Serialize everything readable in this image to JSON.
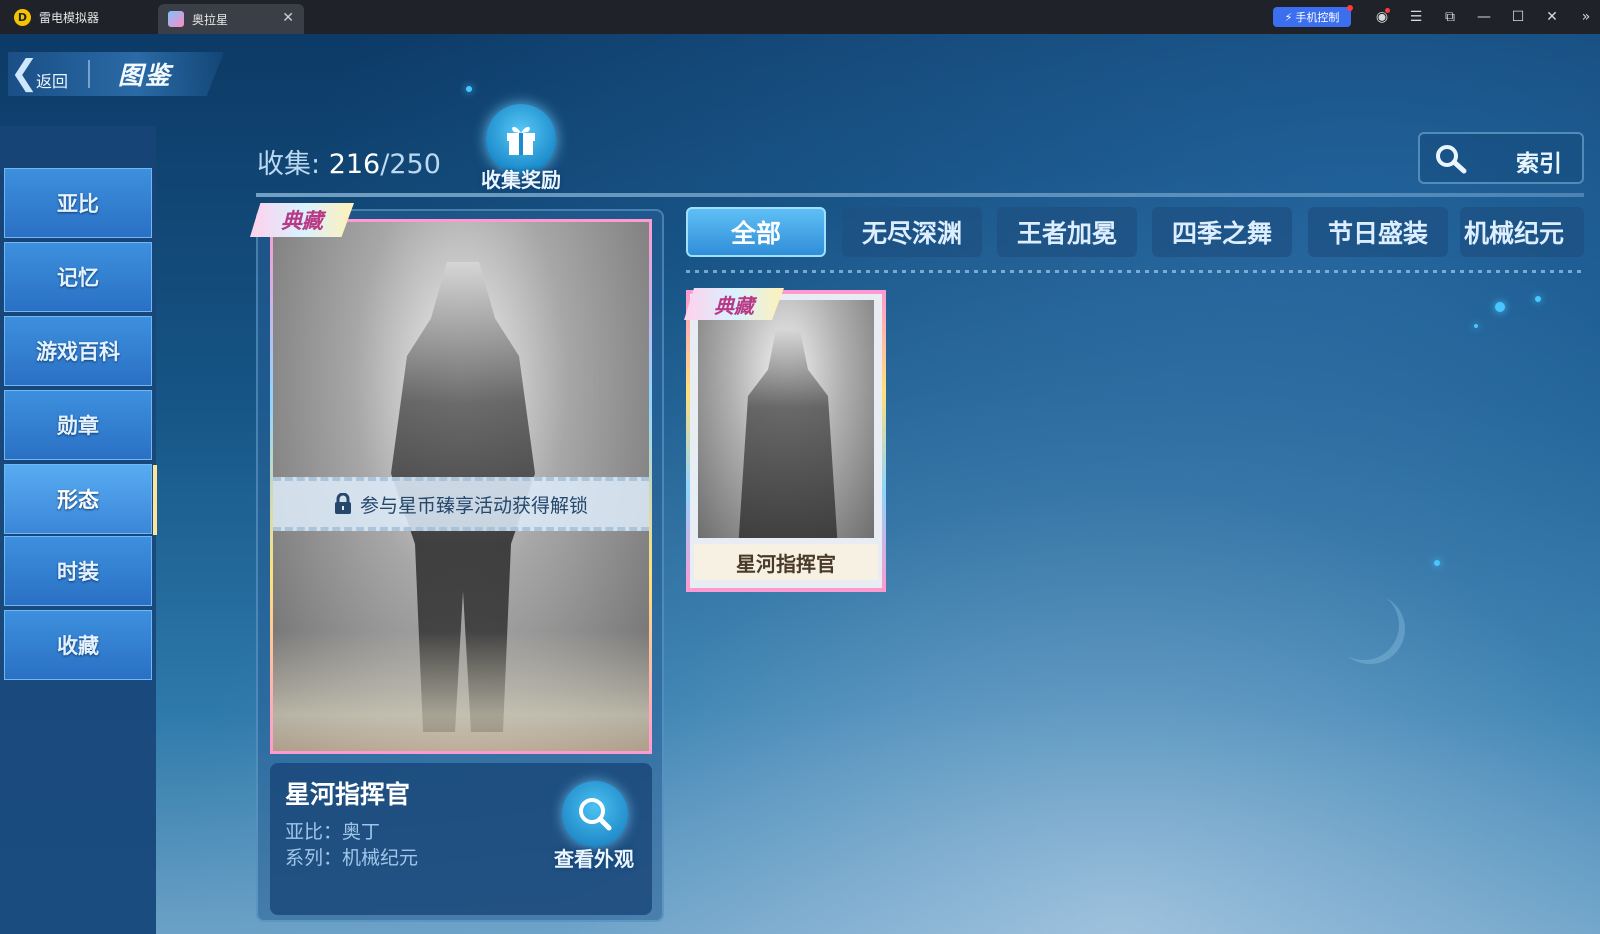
{
  "titlebar": {
    "app_name": "雷电模拟器",
    "tab_title": "奥拉星",
    "tab_close": "✕",
    "phone_control": "手机控制"
  },
  "header": {
    "back_label": "返回",
    "title": "图鉴"
  },
  "sidebar": {
    "items": [
      {
        "label": "亚比"
      },
      {
        "label": "记忆"
      },
      {
        "label": "游戏百科"
      },
      {
        "label": "勋章"
      },
      {
        "label": "形态"
      },
      {
        "label": "时装"
      },
      {
        "label": "收藏"
      }
    ],
    "active_index": 4
  },
  "collection": {
    "label": "收集: ",
    "count": "216",
    "total": "/250",
    "reward_label": "收集奖励"
  },
  "index_button": {
    "label": "索引"
  },
  "detail": {
    "rare_tag": "典藏",
    "lock_text": "参与星币臻享活动获得解锁",
    "name": "星河指挥官",
    "abby_line": "亚比：奥丁",
    "series_line": "系列：机械纪元",
    "view_label": "查看外观"
  },
  "filters": [
    {
      "label": "全部",
      "active": true
    },
    {
      "label": "无尽深渊",
      "active": false
    },
    {
      "label": "王者加冕",
      "active": false
    },
    {
      "label": "四季之舞",
      "active": false
    },
    {
      "label": "节日盛装",
      "active": false
    },
    {
      "label": "机械纪元",
      "active": false
    }
  ],
  "cards": [
    {
      "rare_tag": "典藏",
      "name": "星河指挥官"
    }
  ],
  "colors": {
    "accent": "#3b86d8",
    "rare_tag_text": "#b83a86",
    "phone_control_bg": "#3b6ff0"
  }
}
